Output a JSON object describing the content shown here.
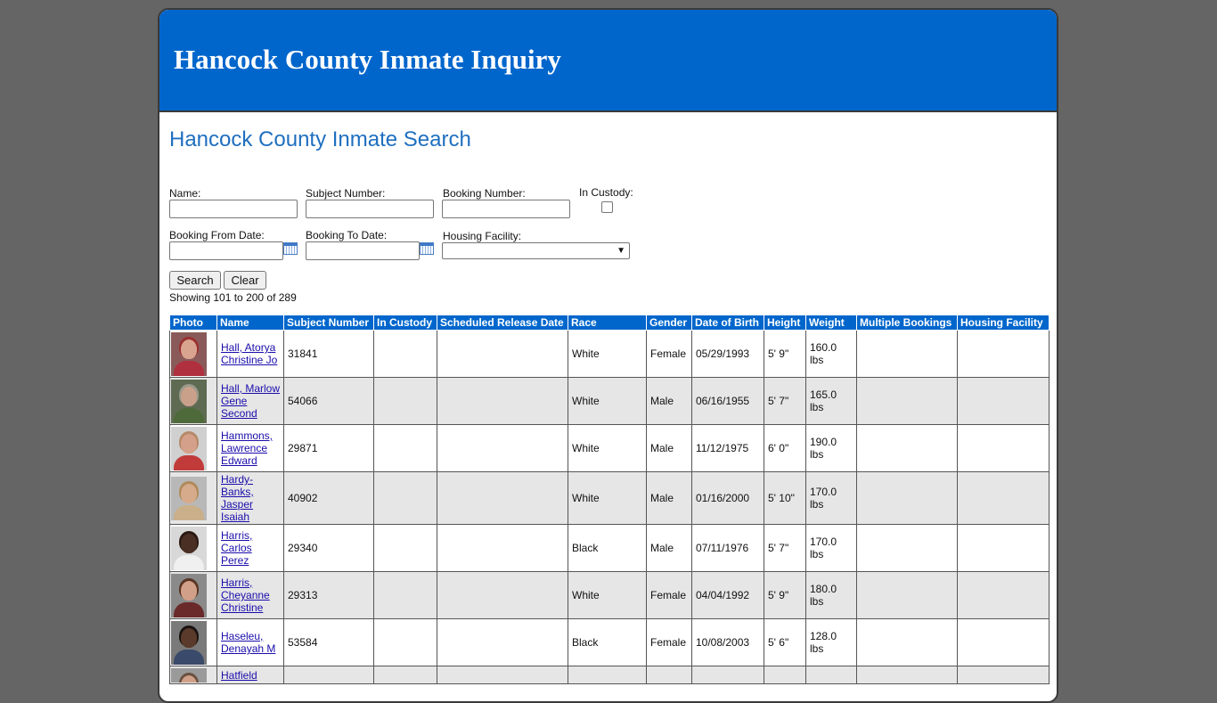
{
  "header": {
    "title": "Hancock County Inmate Inquiry"
  },
  "search": {
    "heading": "Hancock County Inmate Search",
    "name_label": "Name:",
    "name_value": "",
    "subject_number_label": "Subject Number:",
    "subject_number_value": "",
    "booking_number_label": "Booking Number:",
    "booking_number_value": "",
    "in_custody_label": "In Custody:",
    "booking_from_label": "Booking From Date:",
    "booking_from_value": "",
    "booking_to_label": "Booking To Date:",
    "booking_to_value": "",
    "housing_facility_label": "Housing Facility:",
    "housing_facility_value": "",
    "search_button": "Search",
    "clear_button": "Clear"
  },
  "results": {
    "summary": "Showing 101 to 200 of 289",
    "columns": [
      "Photo",
      "Name",
      "Subject Number",
      "In Custody",
      "Scheduled Release Date",
      "Race",
      "Gender",
      "Date of Birth",
      "Height",
      "Weight",
      "Multiple Bookings",
      "Housing Facility"
    ],
    "rows": [
      {
        "name": "Hall, Atorya Christine Jo",
        "subject": "31841",
        "in_custody": "",
        "release": "",
        "race": "White",
        "gender": "Female",
        "dob": "05/29/1993",
        "height": "5' 9\"",
        "weight": "160.0 lbs",
        "multiple": "",
        "facility": "",
        "bg": "#8a5a5a",
        "skin": "#d9a48f",
        "shirt": "#b03040",
        "hair": "#9a3030"
      },
      {
        "name": "Hall, Marlow Gene Second",
        "subject": "54066",
        "in_custody": "",
        "release": "",
        "race": "White",
        "gender": "Male",
        "dob": "06/16/1955",
        "height": "5' 7\"",
        "weight": "165.0 lbs",
        "multiple": "",
        "facility": "",
        "bg": "#5e6b52",
        "skin": "#c9a08a",
        "shirt": "#4f6a3a",
        "hair": "#9a9a8a"
      },
      {
        "name": "Hammons, Lawrence Edward",
        "subject": "29871",
        "in_custody": "",
        "release": "",
        "race": "White",
        "gender": "Male",
        "dob": "11/12/1975",
        "height": "6' 0\"",
        "weight": "190.0 lbs",
        "multiple": "",
        "facility": "",
        "bg": "#d0d0d0",
        "skin": "#d4a08a",
        "shirt": "#c23b3b",
        "hair": "#b58a6a"
      },
      {
        "name": "Hardy-Banks, Jasper Isaiah",
        "subject": "40902",
        "in_custody": "",
        "release": "",
        "race": "White",
        "gender": "Male",
        "dob": "01/16/2000",
        "height": "5' 10\"",
        "weight": "170.0 lbs",
        "multiple": "",
        "facility": "",
        "bg": "#b8b8b8",
        "skin": "#d6ab8c",
        "shirt": "#c9b08a",
        "hair": "#b08a5a"
      },
      {
        "name": "Harris, Carlos Perez",
        "subject": "29340",
        "in_custody": "",
        "release": "",
        "race": "Black",
        "gender": "Male",
        "dob": "07/11/1976",
        "height": "5' 7\"",
        "weight": "170.0 lbs",
        "multiple": "",
        "facility": "",
        "bg": "#d8d8d8",
        "skin": "#4a3024",
        "shirt": "#f0f0f0",
        "hair": "#2a1a12"
      },
      {
        "name": "Harris, Cheyanne Christine",
        "subject": "29313",
        "in_custody": "",
        "release": "",
        "race": "White",
        "gender": "Female",
        "dob": "04/04/1992",
        "height": "5' 9\"",
        "weight": "180.0 lbs",
        "multiple": "",
        "facility": "",
        "bg": "#8a8a8a",
        "skin": "#d2a088",
        "shirt": "#6a2a2a",
        "hair": "#5a3424"
      },
      {
        "name": "Haseleu, Denayah M",
        "subject": "53584",
        "in_custody": "",
        "release": "",
        "race": "Black",
        "gender": "Female",
        "dob": "10/08/2003",
        "height": "5' 6\"",
        "weight": "128.0 lbs",
        "multiple": "",
        "facility": "",
        "bg": "#7a7a7a",
        "skin": "#5a3a2a",
        "shirt": "#3a4a6a",
        "hair": "#1a1210"
      },
      {
        "name": "Hatfield",
        "subject": "",
        "in_custody": "",
        "release": "",
        "race": "",
        "gender": "",
        "dob": "",
        "height": "",
        "weight": "",
        "multiple": "",
        "facility": "",
        "bg": "#9a9a9a",
        "skin": "#d0a088",
        "shirt": "#606060",
        "hair": "#6a5040"
      }
    ]
  }
}
